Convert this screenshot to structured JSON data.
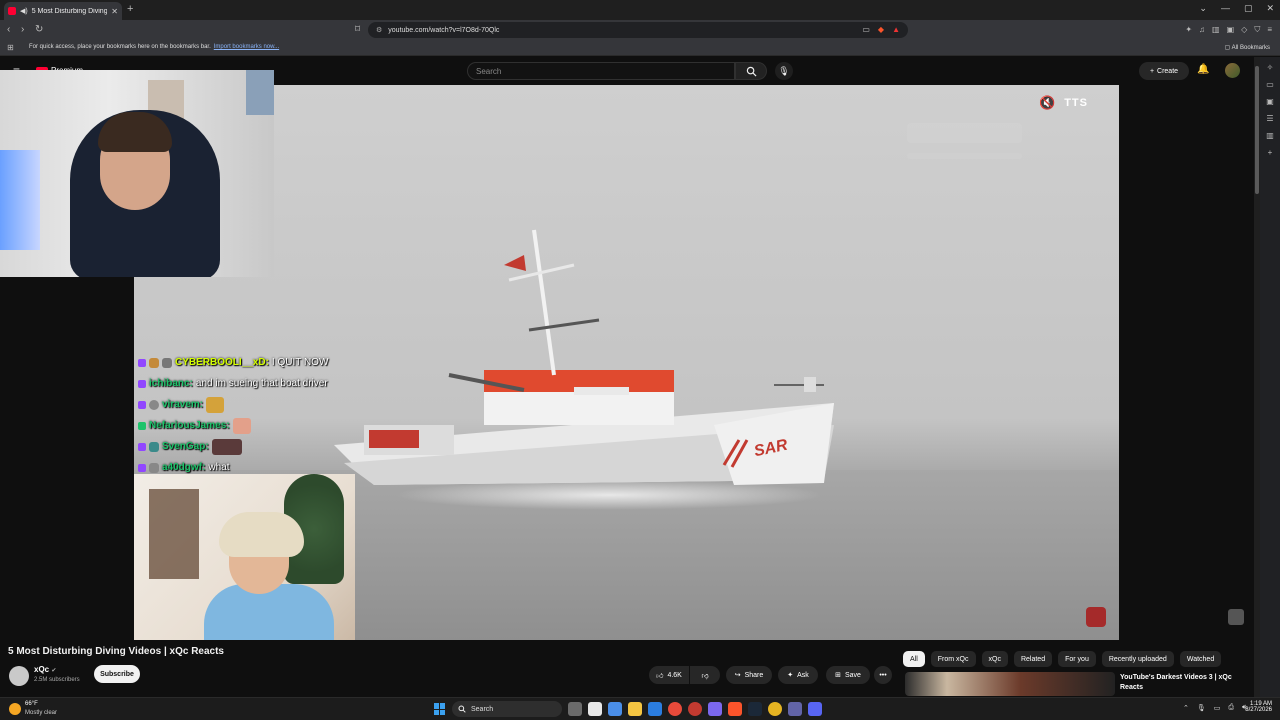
{
  "browser": {
    "tab_title": "5 Most Disturbing Diving Videos | xQc Reacts",
    "url": "youtube.com/watch?v=l7O8d-70Qlc",
    "bookmarks_message": "For quick access, place your bookmarks here on the bookmarks bar.",
    "bookmarks_link": "Import bookmarks now...",
    "all_bookmarks": "All Bookmarks"
  },
  "youtube_header": {
    "logo_text": "Premium",
    "search_placeholder": "Search",
    "create_label": "Create"
  },
  "player": {
    "tts_label": "TTS",
    "hull_text": "SAR"
  },
  "chat": [
    {
      "user": "CYBERBOOLI__xD:",
      "message": "I QUIT NOW",
      "color": "#d4ff00"
    },
    {
      "user": "ichibanc:",
      "message": "and im sueing that boat driver",
      "color": "#1ec36b"
    },
    {
      "user": "viravem:",
      "message": "",
      "color": "#1ec36b"
    },
    {
      "user": "NefariousJames:",
      "message": "",
      "color": "#1ec36b"
    },
    {
      "user": "SvenGap:",
      "message": "",
      "color": "#1ec36b"
    },
    {
      "user": "a40dgwf:",
      "message": "what",
      "color": "#1ec36b"
    }
  ],
  "video": {
    "title": "5 Most Disturbing Diving Videos | xQc Reacts",
    "channel": "xQc",
    "subscribers": "2.5M subscribers",
    "subscribe_label": "Subscribe",
    "likes": "4.6K",
    "share_label": "Share",
    "ask_label": "Ask",
    "save_label": "Save"
  },
  "filter_chips": [
    "All",
    "From xQc",
    "xQc",
    "Related",
    "For you",
    "Recently uploaded",
    "Watched"
  ],
  "recommendation": {
    "title": "YouTube's Darkest Videos 3 | xQc Reacts"
  },
  "taskbar": {
    "temperature": "66°F",
    "weather": "Mostly clear",
    "search_label": "Search",
    "time": "1:19 AM",
    "date": "8/27/2026"
  },
  "colors": {
    "youtube_red": "#ff0033",
    "twitch_purple": "#9147ff",
    "background": "#0f0f0f"
  }
}
